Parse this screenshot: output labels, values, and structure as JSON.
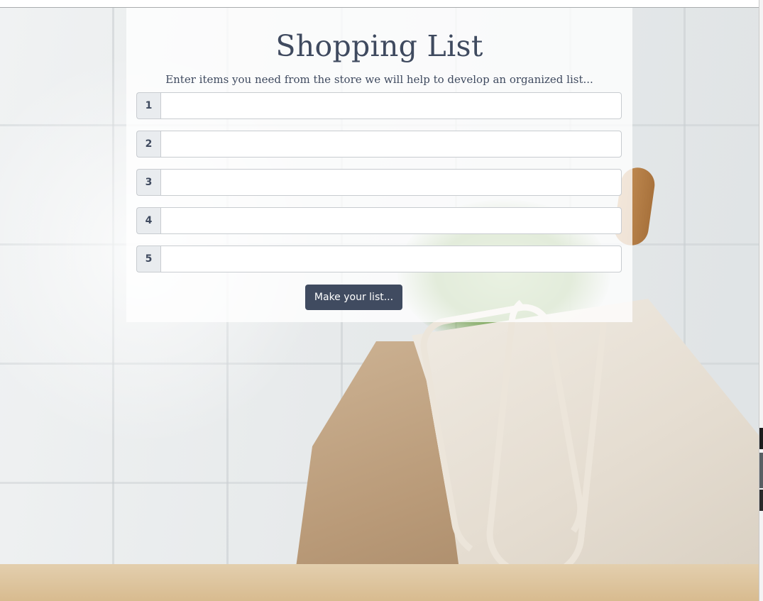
{
  "page": {
    "title": "Shopping List",
    "subtitle": "Enter items you need from the store we will help to develop an organized list..."
  },
  "items": [
    {
      "number": "1",
      "value": ""
    },
    {
      "number": "2",
      "value": ""
    },
    {
      "number": "3",
      "value": ""
    },
    {
      "number": "4",
      "value": ""
    },
    {
      "number": "5",
      "value": ""
    }
  ],
  "actions": {
    "make_list_label": "Make your list..."
  },
  "colors": {
    "accent": "#404b60",
    "text": "#3f4a5f",
    "addon_bg": "#e9ecef"
  }
}
